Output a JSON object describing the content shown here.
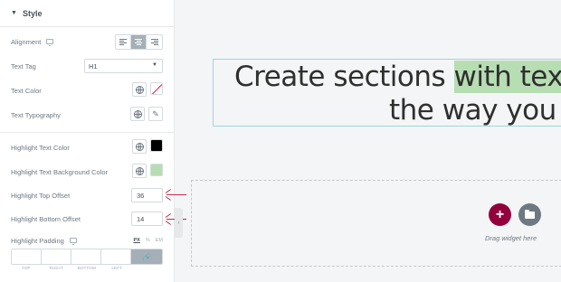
{
  "panel": {
    "section_title": "Style",
    "alignment_label": "Alignment",
    "text_tag_label": "Text Tag",
    "text_tag_value": "H1",
    "text_color_label": "Text Color",
    "text_typography_label": "Text Typography",
    "highlight_text_color_label": "Highlight Text Color",
    "highlight_text_bg_label": "Highlight Text Background Color",
    "highlight_top_offset_label": "Highlight Top Offset",
    "highlight_top_offset_value": "36",
    "highlight_bottom_offset_label": "Highlight Bottom Offset",
    "highlight_bottom_offset_value": "14",
    "highlight_padding_label": "Highlight Padding",
    "units": [
      "PX",
      "%",
      "EM"
    ],
    "dimension_labels": [
      "TOP",
      "RIGHT",
      "BOTTOM",
      "LEFT"
    ]
  },
  "colors": {
    "highlight_text_color": "#000000",
    "highlight_bg_color": "#b7ddb3",
    "arrow_color": "#c4264a",
    "add_button": "#93003c"
  },
  "canvas": {
    "heading_line1_before": "Create sections ",
    "heading_line1_highlight": "with tex",
    "heading_line2": "the way you",
    "drag_text": "Drag widget here"
  }
}
